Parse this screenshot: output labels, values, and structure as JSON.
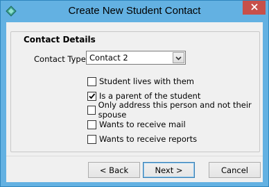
{
  "window": {
    "title": "Create New Student Contact",
    "icon": "app-diamond-icon",
    "close_glyph": "close-icon"
  },
  "group": {
    "title": "Contact Details"
  },
  "contact_type": {
    "label": "Contact Type:",
    "selected": "Contact 2"
  },
  "options": [
    {
      "label": "Student lives with them",
      "checked": false
    },
    {
      "label": "Is a parent of the student",
      "checked": true
    },
    {
      "label": "Only address this person and not their spouse",
      "checked": false
    },
    {
      "label": "Wants to receive mail",
      "checked": false
    },
    {
      "label": "Wants to receive reports",
      "checked": false
    }
  ],
  "buttons": {
    "back": "< Back",
    "next": "Next >",
    "cancel": "Cancel"
  },
  "colors": {
    "titlebar": "#63b1e2",
    "close": "#c7504a",
    "client": "#f0f0f0"
  }
}
